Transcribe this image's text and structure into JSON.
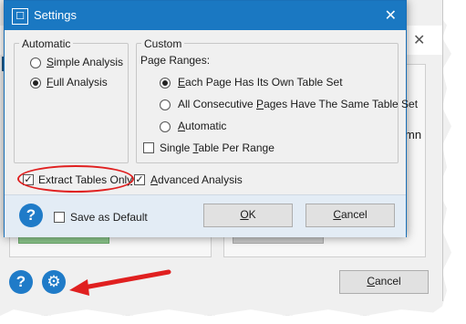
{
  "background_window": {
    "truncated_text": "mn",
    "cancel_label": "Cancel",
    "cancel_underline": "C",
    "cancel_rest": "ancel"
  },
  "dialog": {
    "title": "Settings",
    "close_glyph": "✕",
    "automatic": {
      "label": "Automatic",
      "options": [
        {
          "pre": "",
          "u": "S",
          "post": "imple Analysis",
          "selected": false
        },
        {
          "pre": "",
          "u": "F",
          "post": "ull Analysis",
          "selected": true
        }
      ]
    },
    "custom": {
      "label": "Custom",
      "page_ranges_label": "Page Ranges:",
      "options": [
        {
          "pre": "",
          "u": "E",
          "post": "ach Page Has Its Own Table Set",
          "selected": true
        },
        {
          "pre": "All Consecutive ",
          "u": "P",
          "post": "ages Have The Same Table Set",
          "selected": false
        },
        {
          "pre": "",
          "u": "A",
          "post": "utomatic",
          "selected": false
        }
      ],
      "single_table": {
        "pre": "Single ",
        "u": "T",
        "post": "able Per Range",
        "checked": false
      }
    },
    "extract_tables_only": {
      "pre": "Extract Tables Onl",
      "u": "y",
      "post": "",
      "checked": true
    },
    "advanced_analysis": {
      "pre": "",
      "u": "A",
      "post": "dvanced Analysis",
      "checked": true
    },
    "save_as_default": {
      "label": "Save as Default",
      "checked": false
    },
    "ok": {
      "u": "O",
      "post": "K"
    },
    "cancel": {
      "u": "C",
      "post": "ancel"
    }
  },
  "icons": {
    "help": "?",
    "gear": "⚙",
    "check": "✓"
  },
  "colors": {
    "title_bar": "#1a78c2",
    "help_icon": "#1f7bc8",
    "annotation": "#e02020"
  }
}
